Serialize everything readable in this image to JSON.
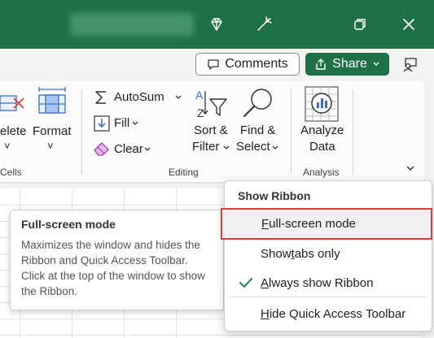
{
  "titlebar": {
    "icons": [
      "diamond-icon",
      "magic-wand-icon",
      "restore-icon",
      "close-icon"
    ]
  },
  "commandbar": {
    "comments_label": "Comments",
    "share_label": "Share"
  },
  "ribbon": {
    "cells": {
      "delete_label_1": "elete",
      "delete_label_2": "˅",
      "format_label": "Format",
      "format_arrow": "˅",
      "group_label": "Cells"
    },
    "editing": {
      "autosum_label": "AutoSum",
      "fill_label": "Fill",
      "clear_label": "Clear",
      "sort_label_1": "Sort &",
      "sort_label_2": "Filter",
      "find_label_1": "Find &",
      "find_label_2": "Select",
      "group_label": "Editing"
    },
    "analysis": {
      "analyze_label_1": "Analyze",
      "analyze_label_2": "Data",
      "group_label": "Analysis"
    }
  },
  "tooltip": {
    "title": "Full-screen mode",
    "body": "Maximizes the window and hides the Ribbon and Quick Access Toolbar. Click at the top of the window to show the Ribbon."
  },
  "menu": {
    "title": "Show Ribbon",
    "items": [
      {
        "first": "F",
        "rest": "ull-screen mode"
      },
      {
        "pre": "Show ",
        "u": "t",
        "post": "abs only"
      },
      {
        "first": "A",
        "rest": "lways show Ribbon"
      },
      {
        "first": "H",
        "rest": "ide Quick Access Toolbar"
      }
    ]
  },
  "colors": {
    "brand": "#1e7145",
    "highlight_border": "#e03c3c",
    "check": "#2e8b57"
  }
}
